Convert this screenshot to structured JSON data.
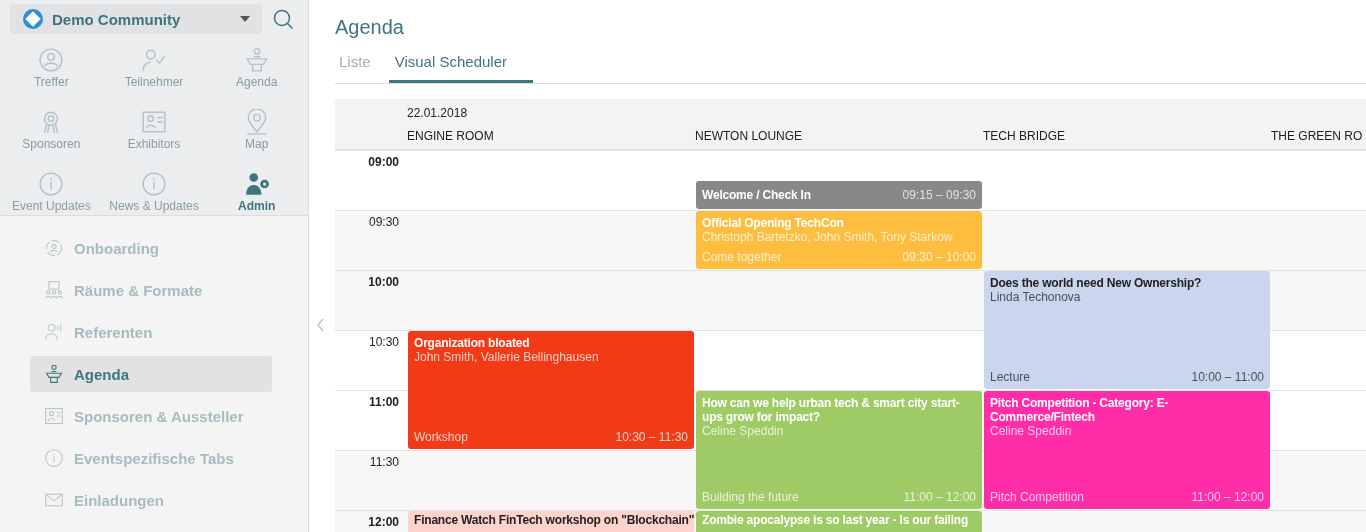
{
  "sidebar": {
    "community": {
      "name": "Demo Community"
    },
    "tiles": [
      {
        "label": "Treffer",
        "kind": "match",
        "selected": false
      },
      {
        "label": "Teilnehmer",
        "kind": "attendee",
        "selected": false
      },
      {
        "label": "Agenda",
        "kind": "podium",
        "selected": false
      },
      {
        "label": "Sponsoren",
        "kind": "award",
        "selected": false
      },
      {
        "label": "Exhibitors",
        "kind": "card",
        "selected": false
      },
      {
        "label": "Map",
        "kind": "pin",
        "selected": false
      },
      {
        "label": "Event Updates",
        "kind": "info",
        "selected": false
      },
      {
        "label": "News & Updates",
        "kind": "info",
        "selected": false
      },
      {
        "label": "Admin",
        "kind": "admin",
        "selected": true
      }
    ],
    "items": [
      {
        "label": "Onboarding",
        "kind": "onboard",
        "selected": false
      },
      {
        "label": "Räume & Formate",
        "kind": "rooms",
        "selected": false
      },
      {
        "label": "Referenten",
        "kind": "speaker",
        "selected": false
      },
      {
        "label": "Agenda",
        "kind": "podium",
        "selected": true
      },
      {
        "label": "Sponsoren & Aussteller",
        "kind": "card",
        "selected": false
      },
      {
        "label": "Eventspezifische Tabs",
        "kind": "info",
        "selected": false
      },
      {
        "label": "Einladungen",
        "kind": "mail",
        "selected": false
      }
    ]
  },
  "page": {
    "title": "Agenda",
    "tabs": [
      {
        "label": "Liste",
        "selected": false
      },
      {
        "label": "Visual Scheduler",
        "selected": true
      }
    ],
    "scheduler": {
      "date": "22.01.2018",
      "times": [
        "09:00",
        "09:30",
        "10:00",
        "10:30",
        "11:00",
        "11:30",
        "12:00"
      ],
      "rooms": [
        {
          "name": "ENGINE ROOM",
          "events": [
            {
              "title": "Organization bloated",
              "speakers": "John Smith, Vallerie Bellinghausen",
              "format": "Workshop",
              "time": "10:30 – 11:30",
              "color": "#f23a17"
            },
            {
              "title": "Finance Watch FinTech workshop on \"Blockchain\"",
              "color": "#fdd3cb"
            }
          ]
        },
        {
          "name": "NEWTON LOUNGE",
          "events": [
            {
              "title": "Welcome / Check In",
              "time": "09:15 – 09:30",
              "color": "#888888"
            },
            {
              "title": "Official Opening TechCon",
              "speakers": "Christoph Bartetzko, John Smith, Tony Starkow",
              "format": "Come together",
              "time": "09:30 – 10:00",
              "color": "#fdbd3f"
            },
            {
              "title": "How can we help urban tech & smart city start-ups grow for impact?",
              "speakers": "Celine Speddin",
              "format": "Building the future",
              "time": "11:00 – 12:00",
              "color": "#9fcb66"
            },
            {
              "title": "Zombie apocalypse is so last year - Is our failing",
              "color": "#9fcb66"
            }
          ]
        },
        {
          "name": "TECH BRIDGE",
          "events": [
            {
              "title": "Does the world need New Ownership?",
              "speakers": "Linda Techonova",
              "format": "Lecture",
              "time": "10:00 – 11:00",
              "color": "#c9d6ee"
            },
            {
              "title": "Pitch Competition - Category: E-Commerce/Fintech",
              "speakers": "Celine Speddin",
              "format": "Pitch Competition",
              "time": "11:00 – 12:00",
              "color": "#ff2da8"
            }
          ]
        },
        {
          "name": "THE GREEN RO"
        }
      ]
    }
  }
}
